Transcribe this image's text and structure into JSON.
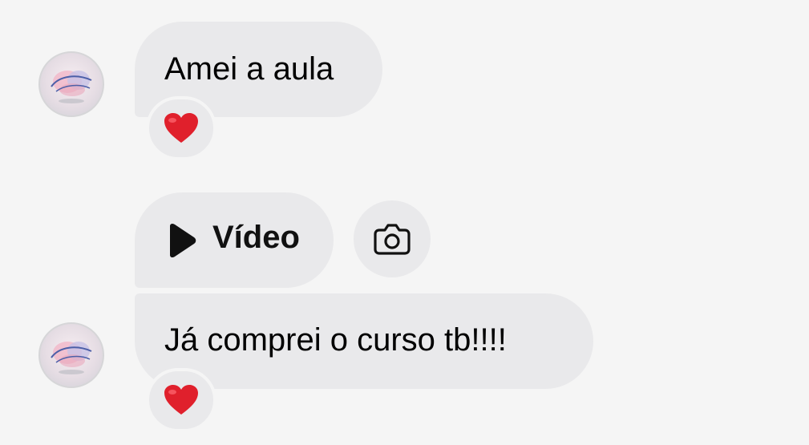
{
  "messages": [
    {
      "sender_avatar": "avatar-arte-lilia",
      "avatar_logo_text": "Arte Lilia",
      "text": "Amei a aula",
      "reaction": "heart-icon"
    },
    {
      "sender_avatar": "avatar-arte-lilia",
      "avatar_logo_text": "Arte Lilia",
      "text": "Já comprei o curso tb!!!!",
      "reaction": "heart-icon"
    }
  ],
  "video_reply": {
    "label": "Vídeo",
    "icon": "play-icon"
  },
  "camera_button": {
    "icon": "camera-icon"
  },
  "colors": {
    "background": "#f5f5f5",
    "bubble": "#e9e9eb",
    "text": "#111111",
    "heart": "#e0202c"
  }
}
